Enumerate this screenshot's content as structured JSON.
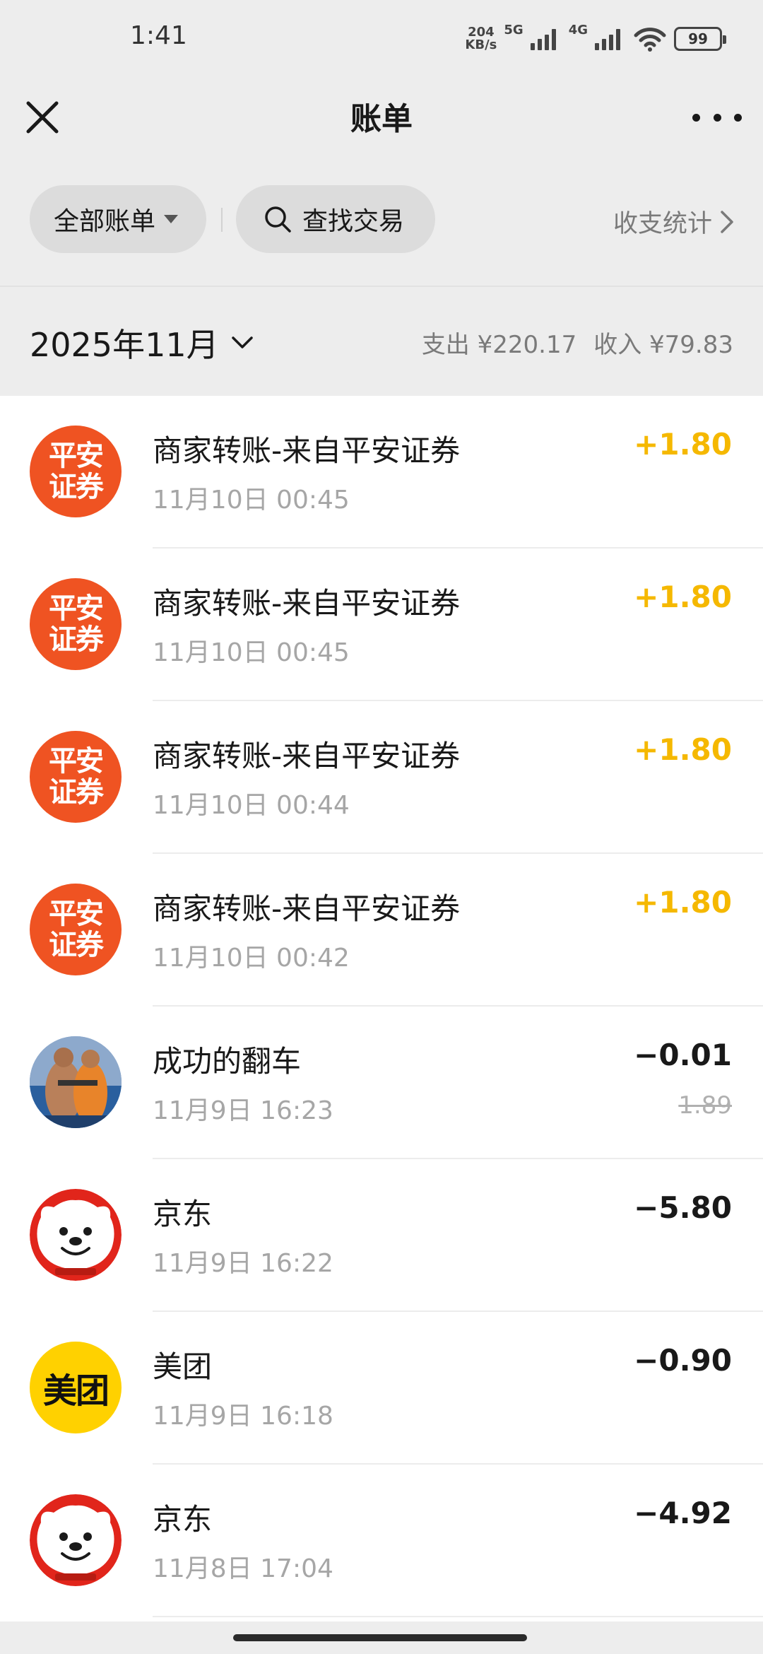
{
  "status_bar": {
    "time": "1:41",
    "net_speed_value": "204",
    "net_speed_unit": "KB/s",
    "net_5g": "5G",
    "net_4g": "4G",
    "battery": "99"
  },
  "nav": {
    "title": "账单"
  },
  "filters": {
    "all_bills_label": "全部账单",
    "search_label": "查找交易",
    "stats_label": "收支统计"
  },
  "month_header": {
    "month": "2025年11月",
    "expense": "支出 ¥220.17",
    "income": "收入 ¥79.83"
  },
  "transactions": [
    {
      "title": "商家转账-来自平安证券",
      "time": "11月10日 00:45",
      "amount": "+1.80",
      "avatar_text_top": "平安",
      "avatar_text_bottom": "证券"
    },
    {
      "title": "商家转账-来自平安证券",
      "time": "11月10日 00:45",
      "amount": "+1.80",
      "avatar_text_top": "平安",
      "avatar_text_bottom": "证券"
    },
    {
      "title": "商家转账-来自平安证券",
      "time": "11月10日 00:44",
      "amount": "+1.80",
      "avatar_text_top": "平安",
      "avatar_text_bottom": "证券"
    },
    {
      "title": "商家转账-来自平安证券",
      "time": "11月10日 00:42",
      "amount": "+1.80",
      "avatar_text_top": "平安",
      "avatar_text_bottom": "证券"
    },
    {
      "title": "成功的翻车",
      "time": "11月9日 16:23",
      "amount": "−0.01",
      "original_amount": "1.89"
    },
    {
      "title": "京东",
      "time": "11月9日 16:22",
      "amount": "−5.80"
    },
    {
      "title": "美团",
      "time": "11月9日 16:18",
      "amount": "−0.90",
      "avatar_text": "美团"
    },
    {
      "title": "京东",
      "time": "11月8日 17:04",
      "amount": "−4.92"
    }
  ],
  "colors": {
    "income": "#f5b800",
    "pingan": "#ef5322",
    "jd": "#e1251b",
    "meituan": "#ffd100",
    "background": "#ededed"
  }
}
